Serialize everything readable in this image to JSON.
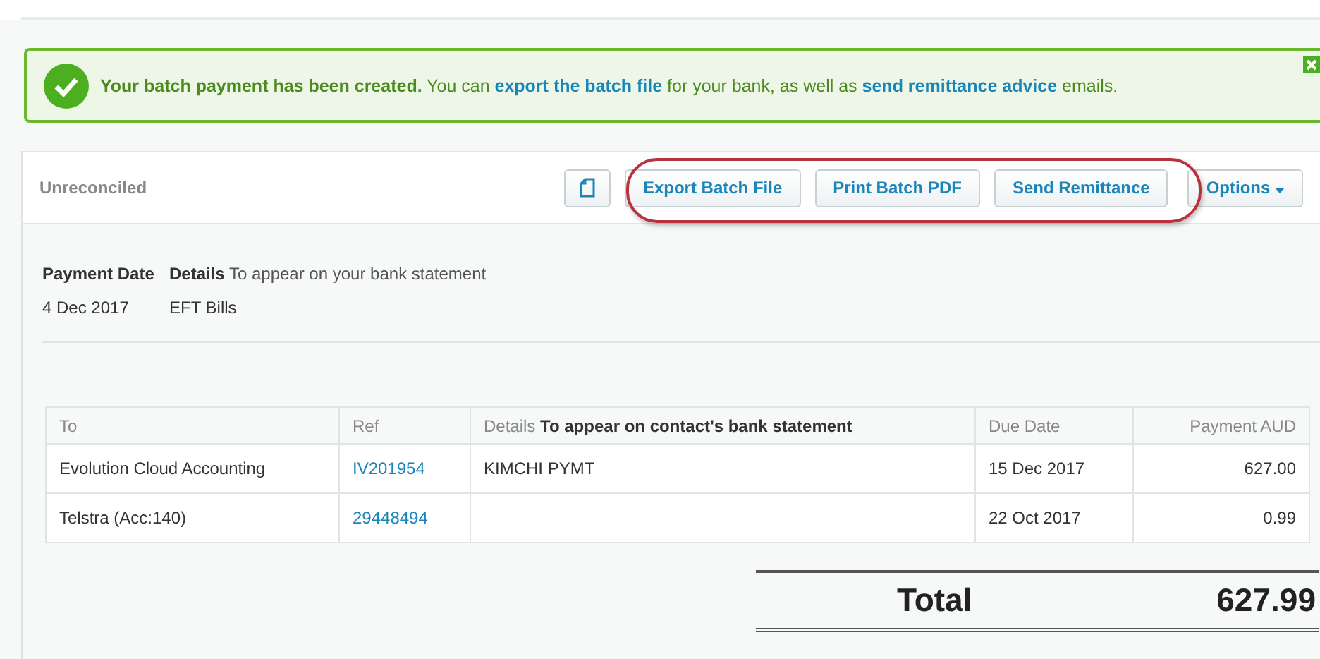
{
  "banner": {
    "parts": [
      {
        "kind": "bold",
        "text": "Your batch payment has been created."
      },
      {
        "kind": "text",
        "text": " You can "
      },
      {
        "kind": "link",
        "text": "export the batch file"
      },
      {
        "kind": "text",
        "text": " for your bank, as well as "
      },
      {
        "kind": "link",
        "text": "send remittance advice"
      },
      {
        "kind": "text",
        "text": " emails."
      }
    ]
  },
  "panel": {
    "status": "Unreconciled",
    "buttons": [
      "Export Batch File",
      "Print Batch PDF",
      "Send Remittance"
    ],
    "options": "Options",
    "highlighted": true
  },
  "summary": {
    "labels": [
      {
        "label": "Payment Date"
      },
      {
        "label": "Details",
        "hint": "To appear on your bank statement"
      }
    ],
    "values": [
      "4 Dec 2017",
      "EFT Bills"
    ]
  },
  "table": {
    "columns": [
      {
        "label": "To"
      },
      {
        "label": "Ref"
      },
      {
        "label": "Details",
        "hint": "To appear on contact's bank statement"
      },
      {
        "label": "Due Date"
      },
      {
        "label": "Payment AUD"
      }
    ],
    "rows": [
      {
        "to": "Evolution Cloud Accounting",
        "ref": "IV201954",
        "details": "KIMCHI PYMT",
        "due": "15 Dec 2017",
        "amount": "627.00"
      },
      {
        "to": "Telstra (Acc:140)",
        "ref": "29448494",
        "details": "",
        "due": "22 Oct 2017",
        "amount": "0.99"
      }
    ]
  },
  "total": {
    "label": "Total",
    "amount": "627.99"
  }
}
